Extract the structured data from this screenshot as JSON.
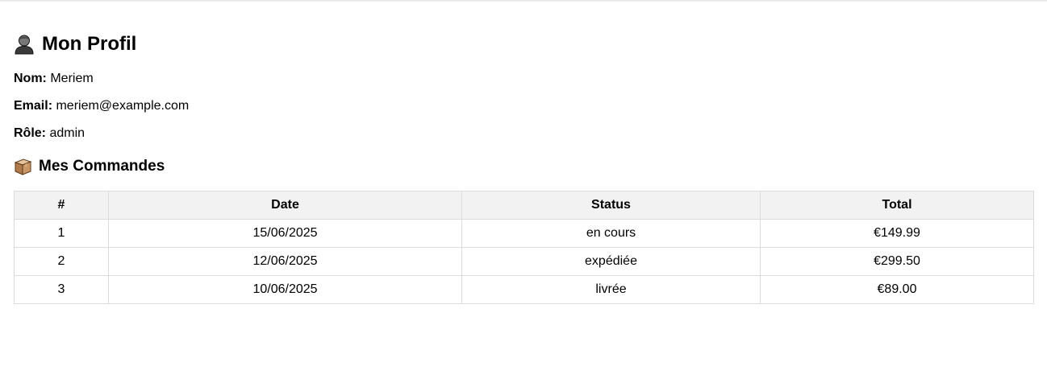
{
  "profile": {
    "title": "Mon Profil",
    "title_icon": "user-silhouette-icon",
    "fields": {
      "nom": {
        "label": "Nom:",
        "value": "Meriem"
      },
      "email": {
        "label": "Email:",
        "value": "meriem@example.com"
      },
      "role": {
        "label": "Rôle:",
        "value": "admin"
      }
    }
  },
  "orders": {
    "title": "Mes Commandes",
    "title_icon": "package-box-icon",
    "columns": [
      "#",
      "Date",
      "Status",
      "Total"
    ],
    "rows": [
      {
        "id": "1",
        "date": "15/06/2025",
        "status": "en cours",
        "total": "€149.99"
      },
      {
        "id": "2",
        "date": "12/06/2025",
        "status": "expédiée",
        "total": "€299.50"
      },
      {
        "id": "3",
        "date": "10/06/2025",
        "status": "livrée",
        "total": "€89.00"
      }
    ]
  },
  "colors": {
    "header_bg": "#f2f2f2",
    "border": "#dcdcdc",
    "text": "#000000"
  }
}
